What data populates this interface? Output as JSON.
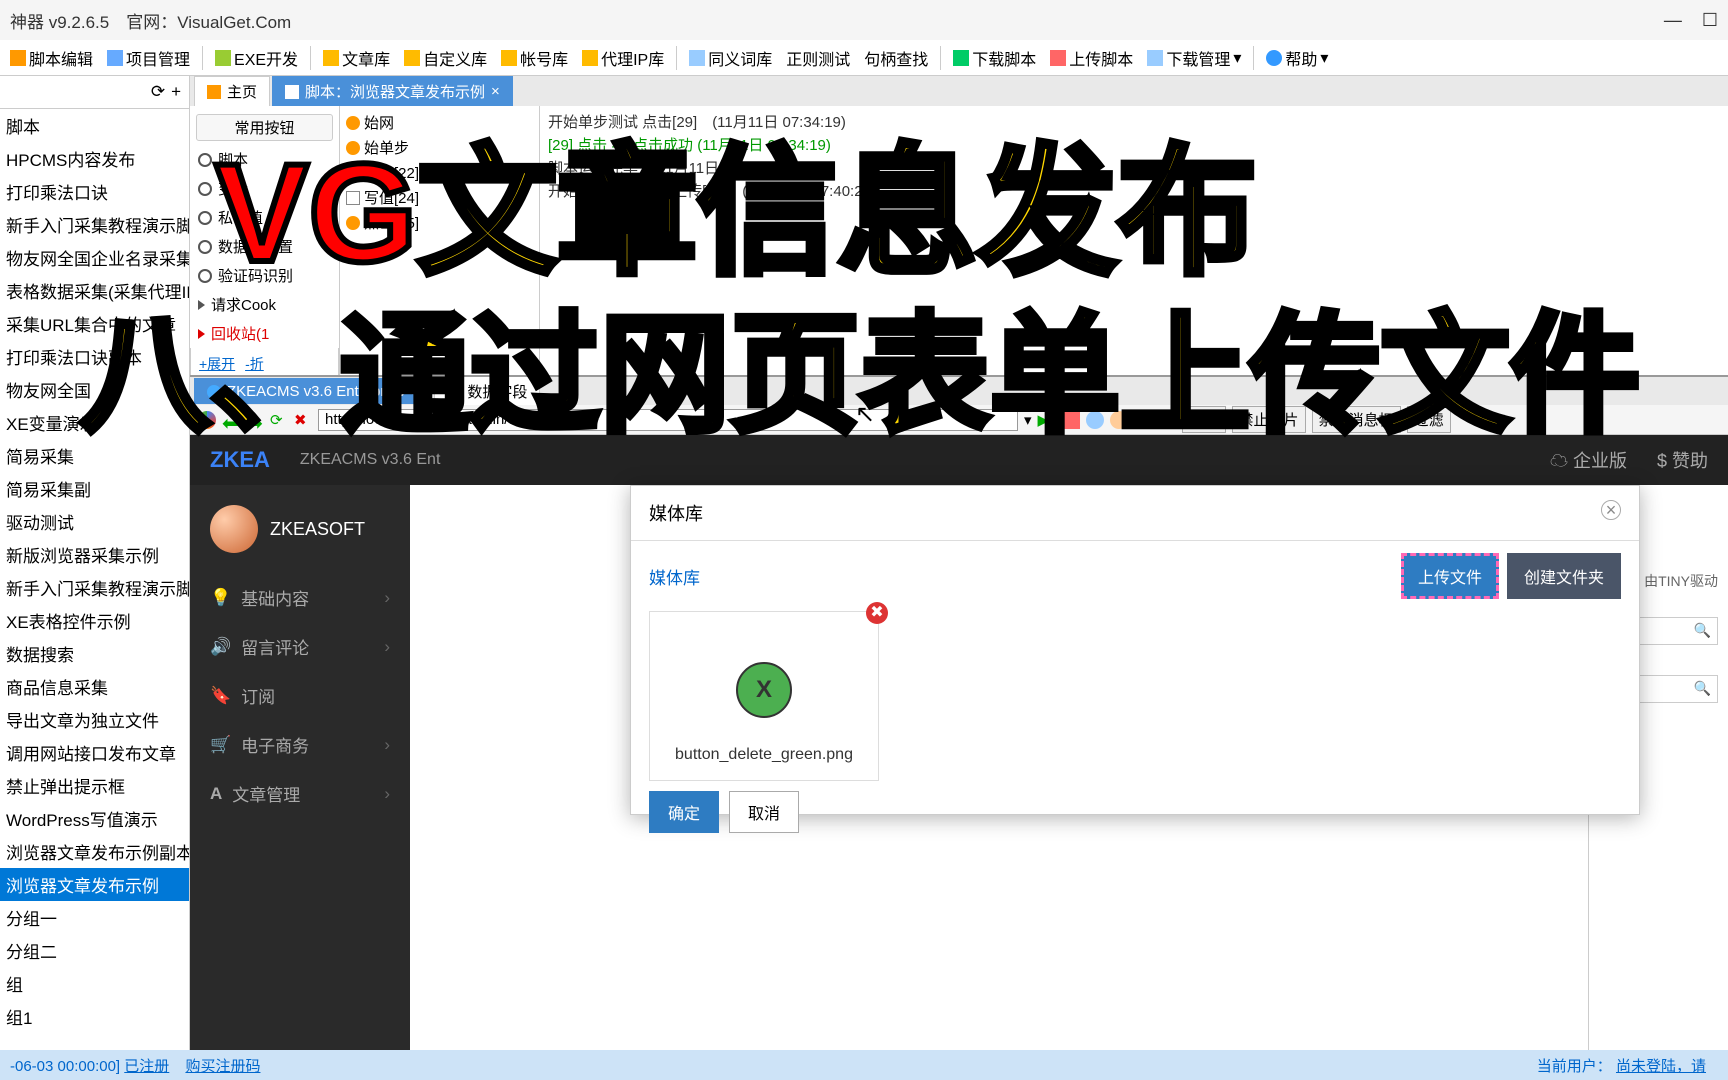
{
  "app": {
    "title": "神器 v9.2.6.5　官网：VisualGet.Com"
  },
  "toolbar": [
    {
      "label": "脚本编辑"
    },
    {
      "label": "项目管理"
    },
    {
      "label": "EXE开发"
    },
    {
      "label": "文章库"
    },
    {
      "label": "自定义库"
    },
    {
      "label": "帐号库"
    },
    {
      "label": "代理IP库"
    },
    {
      "label": "同义词库"
    },
    {
      "label": "正则测试"
    },
    {
      "label": "句柄查找"
    },
    {
      "label": "下载脚本"
    },
    {
      "label": "上传脚本"
    },
    {
      "label": "下载管理"
    },
    {
      "label": "帮助"
    }
  ],
  "left_tree": [
    "脚本",
    "HPCMS内容发布",
    "打印乘法口诀",
    "新手入门采集教程演示脚本",
    "物友网全国企业名录采集",
    "表格数据采集(采集代理IP)",
    "采集URL集合中的文章",
    "打印乘法口诀副本",
    "物友网全国",
    "XE变量演示",
    "简易采集",
    "简易采集副",
    "驱动测试",
    "新版浏览器采集示例",
    "新手入门采集教程演示脚本副本",
    "XE表格控件示例",
    "数据搜索",
    "商品信息采集",
    "导出文章为独立文件",
    "调用网站接口发布文章",
    "禁止弹出提示框",
    "WordPress写值演示",
    "浏览器文章发布示例副本",
    "浏览器文章发布示例",
    "分组一",
    "分组二",
    "组",
    "组1"
  ],
  "left_selected": "浏览器文章发布示例",
  "tabs": {
    "home": "主页",
    "script": "脚本：浏览器文章发布示例"
  },
  "script_panel": {
    "btn": "常用按钮",
    "items": [
      "脚本",
      "变量",
      "私有值",
      "数据库配置",
      "验证码识别",
      "请求Cook",
      "回收站(1"
    ],
    "mid": [
      "始网",
      "始单步",
      "写值[22]",
      "写值[24]",
      "点击[25]"
    ],
    "expand": "+展开",
    "collapse": "-折",
    "log": [
      {
        "text": "开始单步测试 点击[29]　(11月11日 07:34:19)"
      },
      {
        "text": "[29] 点击 => 点击成功 (11月11日 07:34:19)",
        "green": true
      },
      {
        "text": "脚本运行完毕　(11月11日 07:34:19)"
      },
      {
        "text": "开始单步测试 文件上传[30]　(11月11日 07:40:28)"
      }
    ]
  },
  "browser": {
    "tab1": "ZKEACMS v3.6 Enterprise",
    "tab2": "数据字段",
    "url": "http://localhost:5000/admin/article/create",
    "btns": [
      "抓包",
      "禁止图片",
      "禁止消息框",
      "过滤"
    ]
  },
  "cms": {
    "logo": "ZKEA",
    "title": "ZKEACMS v3.6 Ent",
    "user": "ZKEASOFT",
    "menu": [
      "基础内容",
      "留言评论",
      "订阅",
      "电子商务",
      "文章管理"
    ],
    "right": [
      "企业版",
      "$ 赞助"
    ],
    "rs": "0 字 由TINY驱动"
  },
  "modal": {
    "title": "媒体库",
    "crumb": "媒体库",
    "upload": "上传文件",
    "folder": "创建文件夹",
    "file": "button_delete_green.png",
    "ok": "确定",
    "cancel": "取消"
  },
  "overlay": {
    "vg": "VG",
    "t1": "文章信息发布",
    "t2": "八、通过网页表单上传文件"
  },
  "status": {
    "date": "-06-03 00:00:00]",
    "reg": "已注册",
    "buy": "购买注册码",
    "user": "当前用户：",
    "login": "尚未登陆，请"
  }
}
